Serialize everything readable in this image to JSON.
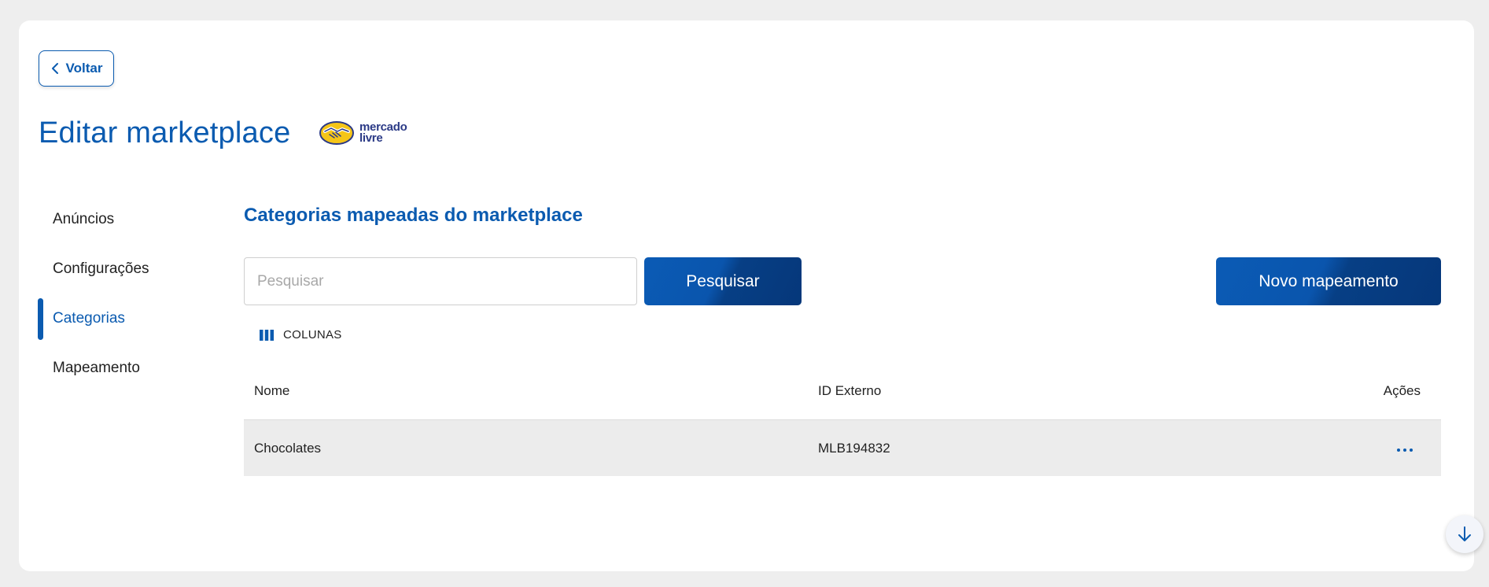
{
  "header": {
    "back_label": "Voltar",
    "title": "Editar marketplace",
    "logo": {
      "line1": "mercado",
      "line2": "livre",
      "icon": "handshake-icon"
    }
  },
  "sidebar": {
    "items": [
      {
        "label": "Anúncios",
        "active": false
      },
      {
        "label": "Configurações",
        "active": false
      },
      {
        "label": "Categorias",
        "active": true
      },
      {
        "label": "Mapeamento",
        "active": false
      }
    ]
  },
  "main": {
    "section_title": "Categorias mapeadas do marketplace",
    "search": {
      "placeholder": "Pesquisar",
      "value": ""
    },
    "search_button": "Pesquisar",
    "new_button": "Novo mapeamento",
    "columns_toggle": "COLUNAS",
    "table": {
      "headers": [
        "Nome",
        "ID Externo",
        "Ações"
      ],
      "rows": [
        {
          "nome": "Chocolates",
          "id_externo": "MLB194832"
        }
      ]
    }
  },
  "colors": {
    "primary": "#0b5bb0",
    "primary_dark": "#05377a",
    "page_bg": "#eeeeee",
    "row_bg": "#ececec"
  }
}
